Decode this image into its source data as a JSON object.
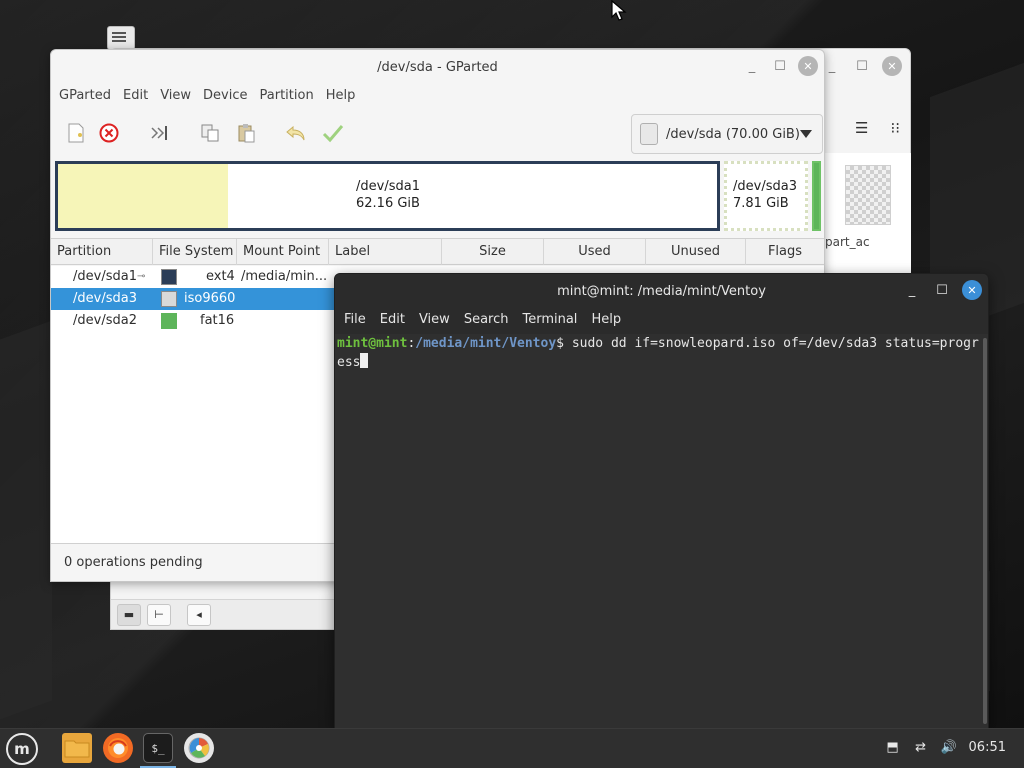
{
  "desktop": {
    "icon": "terminal-shortcut-icon"
  },
  "file_manager": {
    "file_label": "part_ac",
    "view_icons": [
      "list-view-icon",
      "compact-view-icon"
    ]
  },
  "gparted": {
    "title": "/dev/sda - GParted",
    "menu": [
      "GParted",
      "Edit",
      "View",
      "Device",
      "Partition",
      "Help"
    ],
    "toolbar": [
      "new-icon",
      "delete-icon",
      "resize-move-icon",
      "copy-icon",
      "paste-icon",
      "undo-icon",
      "apply-icon"
    ],
    "device_select": "/dev/sda (70.00 GiB)",
    "map": {
      "sda1_name": "/dev/sda1",
      "sda1_size": "62.16 GiB",
      "sda3_name": "/dev/sda3",
      "sda3_size": "7.81 GiB"
    },
    "columns": [
      "Partition",
      "File System",
      "Mount Point",
      "Label",
      "Size",
      "Used",
      "Unused",
      "Flags"
    ],
    "rows": [
      {
        "partition": "/dev/sda1",
        "fs": "ext4",
        "mount": "/media/min...",
        "color": "#2b3d57"
      },
      {
        "partition": "/dev/sda3",
        "fs": "iso9660",
        "mount": "",
        "color": "#d9d9d9"
      },
      {
        "partition": "/dev/sda2",
        "fs": "fat16",
        "mount": "",
        "color": "#5db55a"
      }
    ],
    "status": "0 operations pending"
  },
  "terminal": {
    "title": "mint@mint: /media/mint/Ventoy",
    "menu": [
      "File",
      "Edit",
      "View",
      "Search",
      "Terminal",
      "Help"
    ],
    "prompt_user": "mint@mint",
    "prompt_sep": ":",
    "prompt_path": "/media/mint/Ventoy",
    "prompt_end": "$",
    "command": " sudo dd if=snowleopard.iso of=/dev/sda3 status=progress"
  },
  "taskbar": {
    "menu_icon": "mint-menu-icon",
    "apps": [
      "files-icon",
      "firefox-icon",
      "terminal-icon",
      "gparted-icon"
    ],
    "terminal_glyph": "$_",
    "clock": "06:51",
    "tray": [
      "updates-icon",
      "network-icon",
      "volume-icon"
    ]
  }
}
